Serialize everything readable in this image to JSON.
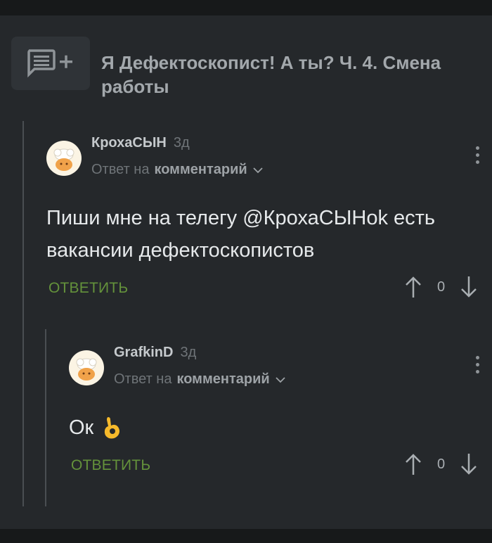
{
  "post": {
    "icon": "add-comment-icon",
    "title": "Я Дефектоскопист! А ты? Ч. 4. Смена работы"
  },
  "comments": [
    {
      "author": "КрохаСЫН",
      "time": "3д",
      "reply_prefix": "Ответ на",
      "reply_target": "комментарий",
      "text": "Пиши мне на телегу @КрохаСЫНok есть вакансии дефектоскопистов",
      "reply_label": "ОТВЕТИТЬ",
      "votes": "0"
    },
    {
      "author": "GrafkinD",
      "time": "3д",
      "reply_prefix": "Ответ на",
      "reply_target": "комментарий",
      "text": "Ок",
      "reply_label": "ОТВЕТИТЬ",
      "votes": "0"
    }
  ],
  "colors": {
    "background": "#25282b",
    "accent_green": "#64923b",
    "thread_line": "#4a4e52"
  }
}
